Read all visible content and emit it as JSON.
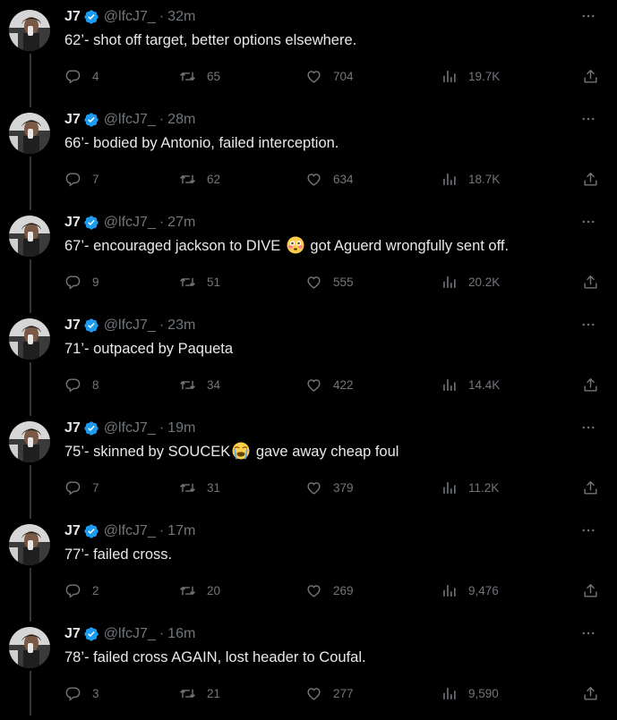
{
  "tweets": [
    {
      "name": "J7",
      "handle": "@lfcJ7_",
      "time": "32m",
      "text_parts": [
        "62’- shot off target, better options elsewhere."
      ],
      "replies": "4",
      "retweets": "65",
      "likes": "704",
      "views": "19.7K"
    },
    {
      "name": "J7",
      "handle": "@lfcJ7_",
      "time": "28m",
      "text_parts": [
        "66’- bodied by Antonio, failed interception."
      ],
      "replies": "7",
      "retweets": "62",
      "likes": "634",
      "views": "18.7K"
    },
    {
      "name": "J7",
      "handle": "@lfcJ7_",
      "time": "27m",
      "text_parts": [
        "67’- encouraged jackson to DIVE ",
        "flushed-face-emoji",
        " got Aguerd wrongfully sent off."
      ],
      "replies": "9",
      "retweets": "51",
      "likes": "555",
      "views": "20.2K"
    },
    {
      "name": "J7",
      "handle": "@lfcJ7_",
      "time": "23m",
      "text_parts": [
        "71’- outpaced by Paqueta"
      ],
      "replies": "8",
      "retweets": "34",
      "likes": "422",
      "views": "14.4K"
    },
    {
      "name": "J7",
      "handle": "@lfcJ7_",
      "time": "19m",
      "text_parts": [
        "75’- skinned by SOUCEK",
        "loudly-crying-emoji",
        " gave away cheap foul"
      ],
      "replies": "7",
      "retweets": "31",
      "likes": "379",
      "views": "11.2K"
    },
    {
      "name": "J7",
      "handle": "@lfcJ7_",
      "time": "17m",
      "text_parts": [
        "77’- failed cross."
      ],
      "replies": "2",
      "retweets": "20",
      "likes": "269",
      "views": "9,476"
    },
    {
      "name": "J7",
      "handle": "@lfcJ7_",
      "time": "16m",
      "text_parts": [
        "78’- failed cross AGAIN, lost header to Coufal."
      ],
      "replies": "3",
      "retweets": "21",
      "likes": "277",
      "views": "9,590"
    }
  ],
  "colors": {
    "background": "#000000",
    "text": "#e7e9ea",
    "muted": "#71767b",
    "verified": "#1d9bf0",
    "rail": "#333639"
  },
  "icons": [
    "verified-badge-icon",
    "more-icon",
    "reply-icon",
    "retweet-icon",
    "like-icon",
    "views-icon",
    "share-icon"
  ]
}
